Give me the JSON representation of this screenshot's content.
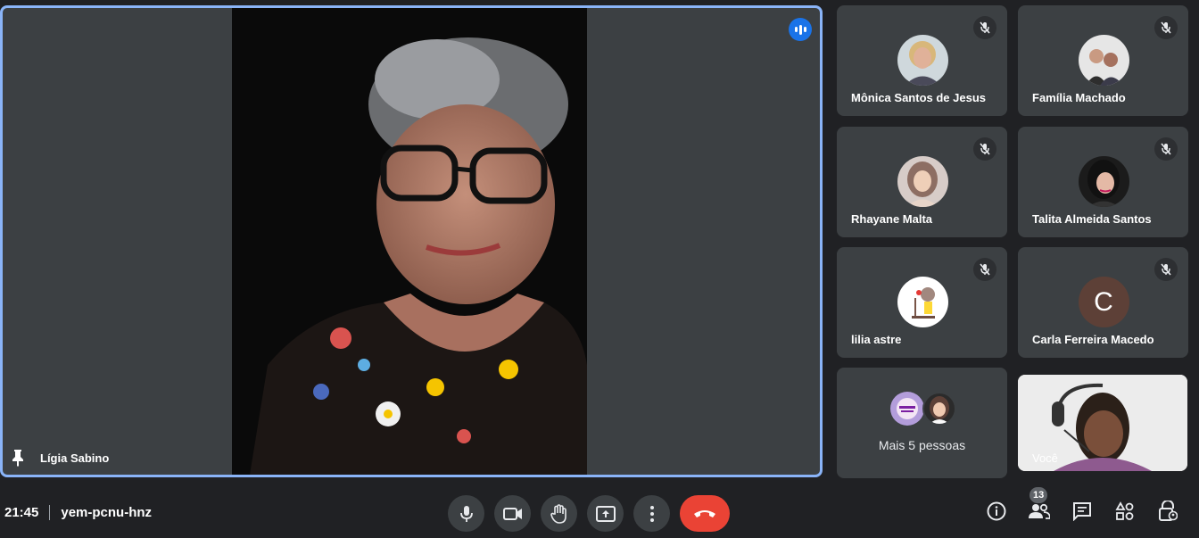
{
  "main_speaker": {
    "name": "Lígia Sabino"
  },
  "participants": [
    {
      "name": "Mônica Santos de Jesus"
    },
    {
      "name": "Família Machado"
    },
    {
      "name": "Rhayane Malta"
    },
    {
      "name": "Talita Almeida Santos"
    },
    {
      "name": "lilia astre"
    },
    {
      "name": "Carla Ferreira Macedo",
      "initial": "C"
    }
  ],
  "more_tile": {
    "label": "Mais 5 pessoas"
  },
  "self_tile": {
    "label": "Você"
  },
  "meeting": {
    "time": "21:45",
    "code": "yem-pcnu-hnz"
  },
  "people_count": "13",
  "colors": {
    "accent": "#8ab4f8",
    "leave": "#ea4335",
    "speaking": "#1a73e8",
    "tile": "#3c4043",
    "background": "#202124"
  }
}
